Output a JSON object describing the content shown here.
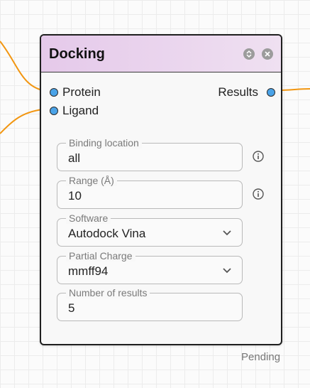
{
  "node": {
    "title": "Docking",
    "header_buttons": {
      "collapse_icon": "collapse-icon",
      "close_icon": "close-icon"
    },
    "inputs": [
      {
        "label": "Protein",
        "port_color": "#4aa3e8"
      },
      {
        "label": "Ligand",
        "port_color": "#4aa3e8"
      }
    ],
    "outputs": [
      {
        "label": "Results",
        "port_color": "#4aa3e8"
      }
    ],
    "fields": {
      "binding_location": {
        "label": "Binding location",
        "value": "all",
        "info_icon": "info-icon"
      },
      "range": {
        "label": "Range (Å)",
        "value": "10",
        "info_icon": "info-icon"
      },
      "software": {
        "label": "Software",
        "value": "Autodock Vina",
        "control": "select"
      },
      "partial_charge": {
        "label": "Partial Charge",
        "value": "mmff94",
        "control": "select"
      },
      "number_of_results": {
        "label": "Number of results",
        "value": "5"
      }
    },
    "status": "Pending"
  },
  "colors": {
    "edge": "#f29611",
    "header_gradient_start": "#e5c9ea",
    "header_gradient_end": "#efe0f1",
    "port": "#4aa3e8",
    "border": "#1f1f1f"
  }
}
